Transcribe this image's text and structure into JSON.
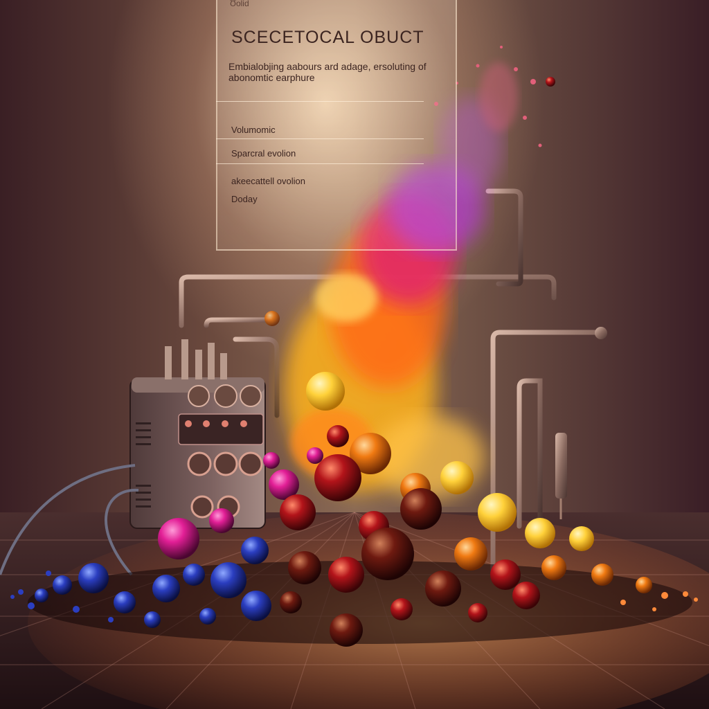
{
  "panel": {
    "tab": "Ʊolid",
    "title": "SCECETOCAL OBUCT",
    "description": "Embialobjing aabours ard adage, ersoluting of abonomtic earphure",
    "items": [
      "Volumomic",
      "Sparcral evolion",
      "akeecattell ovolion",
      "Doday"
    ]
  },
  "colors": {
    "wall_light": "#f3d9bf",
    "floor": "#2b1518",
    "cloud_orange": "#ff7a1a",
    "cloud_magenta": "#d21f7a",
    "cloud_purple": "#9a3bd0",
    "spheres_blue": "#2438b8",
    "spheres_yellow": "#ffd44a"
  }
}
